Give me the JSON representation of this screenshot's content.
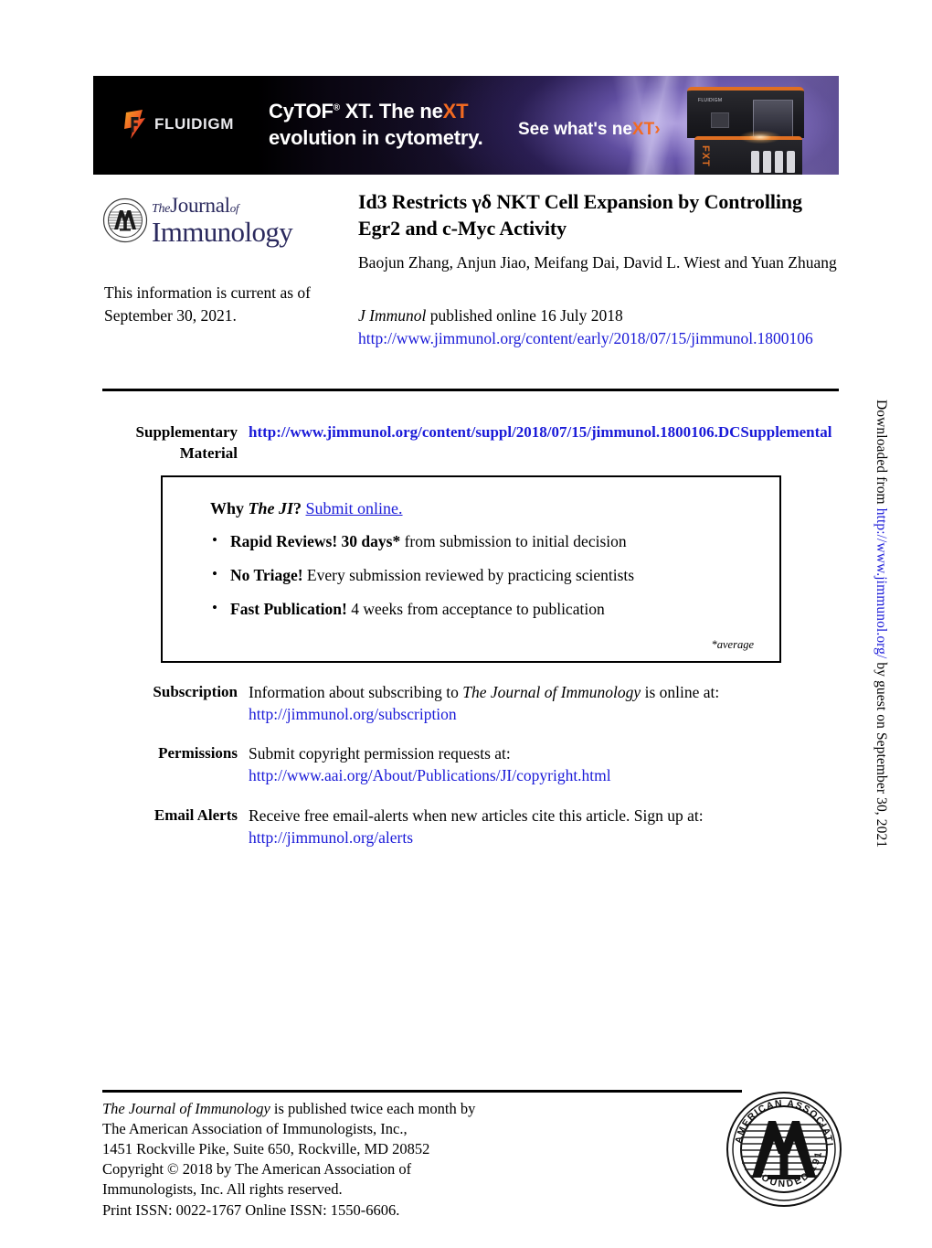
{
  "banner": {
    "brand": "FLUIDIGM",
    "brand_trademark": "•",
    "headline_line1_a": "CyTOF",
    "headline_reg": "®",
    "headline_line1_b": " XT. The ne",
    "headline_line1_c": "XT",
    "headline_line2": "evolution in cytometry.",
    "cta_a": "See what's ne",
    "cta_b": "XT",
    "cta_arrow": "›",
    "device_label": "FXT",
    "device_logo": "FLUIDIGM"
  },
  "journal_logo": {
    "the": "The",
    "journal": "Journal",
    "of": "of",
    "immunology": "Immunology",
    "color": "#2b2a5e"
  },
  "header": {
    "current_as_of": "This information is current as of September 30, 2021.",
    "article_title": "Id3 Restricts γδ NKT Cell Expansion by Controlling Egr2 and c-Myc Activity",
    "authors": "Baojun Zhang, Anjun Jiao, Meifang Dai, David L. Wiest and Yuan Zhuang",
    "journal_abbrev": "J Immunol",
    "publication_status": " published online 16 July 2018",
    "article_url": "http://www.jimmunol.org/content/early/2018/07/15/jimmunol.1800106"
  },
  "side_note": {
    "prefix": "Downloaded from ",
    "url": "http://www.jimmunol.org/",
    "suffix": " by guest on September 30, 2021"
  },
  "supplementary": {
    "label_line1": "Supplementary",
    "label_line2": "Material",
    "url": "http://www.jimmunol.org/content/suppl/2018/07/15/jimmunol.1800106.DCSupplemental"
  },
  "why_box": {
    "head_why": "Why ",
    "head_theji": "The JI",
    "head_q": "? ",
    "head_link": "Submit online.",
    "bullets": [
      {
        "bold": "Rapid Reviews! 30 days*",
        "rest": " from submission to initial decision"
      },
      {
        "bold": "No Triage!",
        "rest": " Every submission reviewed by practicing scientists"
      },
      {
        "bold": "Fast Publication!",
        "rest": " 4 weeks from acceptance to publication"
      }
    ],
    "footnote": "*average"
  },
  "info_rows": {
    "subscription": {
      "label": "Subscription",
      "text_a": "Information about subscribing to ",
      "text_italic": "The Journal of Immunology",
      "text_b": " is online at:",
      "url": "http://jimmunol.org/subscription"
    },
    "permissions": {
      "label": "Permissions",
      "text": "Submit copyright permission requests at:",
      "url": "http://www.aai.org/About/Publications/JI/copyright.html"
    },
    "email_alerts": {
      "label": "Email Alerts",
      "text": "Receive free email-alerts when new articles cite this article. Sign up at:",
      "url": "http://jimmunol.org/alerts"
    }
  },
  "footer": {
    "line1_italic": "The Journal of Immunology",
    "line1_rest": " is published twice each month by",
    "line2": "The American Association of Immunologists, Inc.,",
    "line3": "1451 Rockville Pike, Suite 650, Rockville, MD 20852",
    "line4": "Copyright © 2018 by The American Association of",
    "line5": "Immunologists, Inc. All rights reserved.",
    "line6": "Print ISSN: 0022-1767 Online ISSN: 1550-6606."
  },
  "aai_seal": {
    "outer_text": "AMERICAN ASSOCIATION OF IMMUNOLOGISTS",
    "founded": "FOUNDED 1913",
    "monogram": "AAI"
  },
  "colors": {
    "link": "#1a1ad8",
    "logo_navy": "#2b2a5e",
    "accent_orange": "#f26a21",
    "rule": "#000000"
  }
}
